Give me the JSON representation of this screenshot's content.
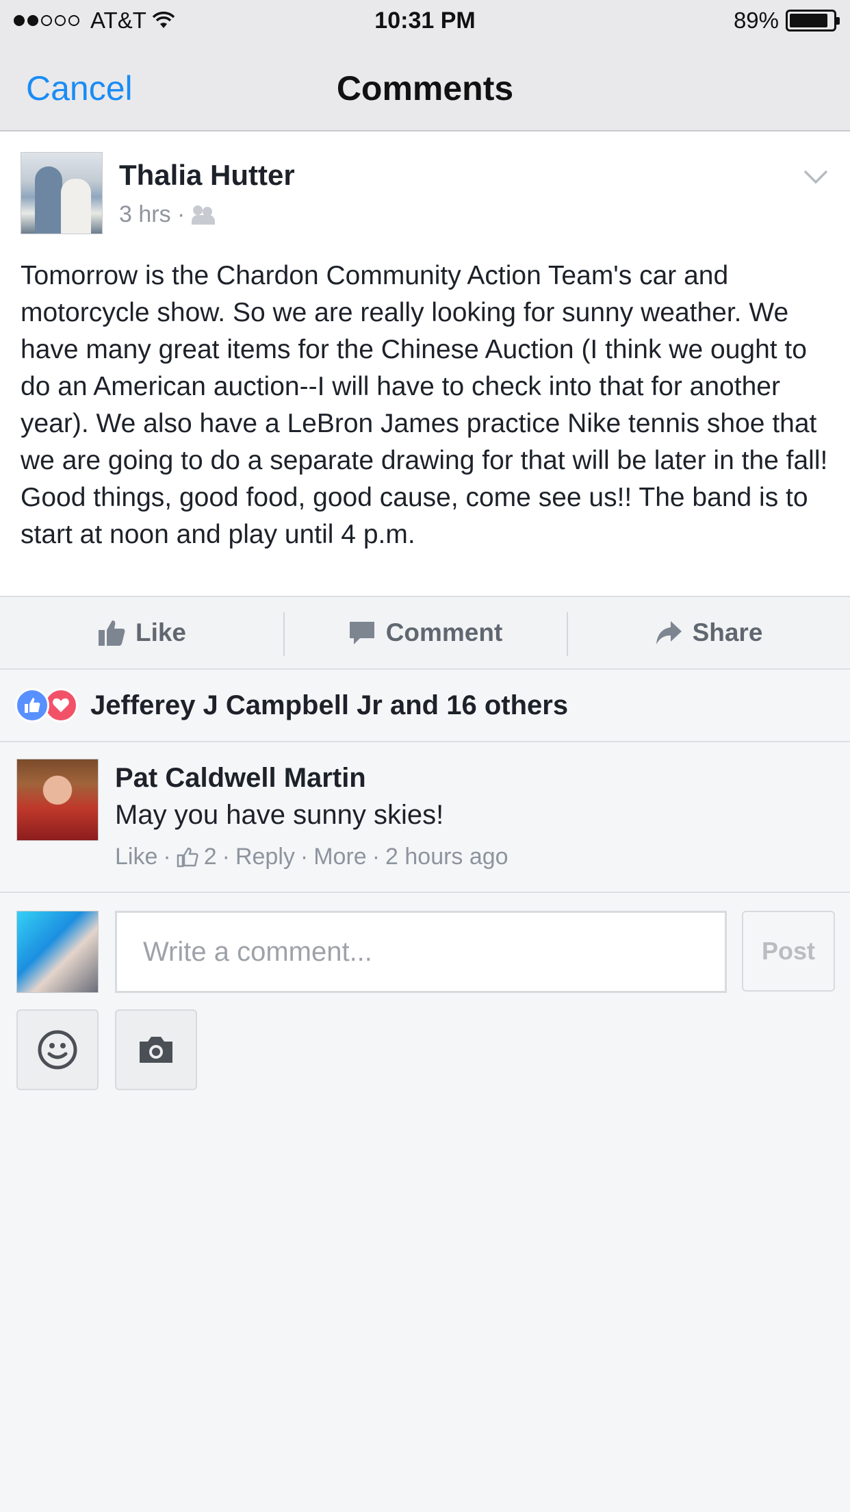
{
  "status_bar": {
    "carrier": "AT&T",
    "time": "10:31 PM",
    "battery": "89%",
    "battery_level": 0.89
  },
  "nav": {
    "cancel_label": "Cancel",
    "title": "Comments"
  },
  "post": {
    "author": "Thalia Hutter",
    "time": "3 hrs ·",
    "audience_icon": "friends-icon",
    "text": "Tomorrow is the Chardon Community Action Team's car and motorcycle show. So we are really looking for sunny weather. We have many great items for the Chinese Auction (I think we ought to do an American auction--I will have to check into that for another year). We also have a LeBron James practice Nike tennis shoe that we are going to do a separate drawing for that will be later in the fall! Good things, good food, good cause, come see us!! The band is to start at noon and play until 4 p.m."
  },
  "actions": {
    "like": "Like",
    "comment": "Comment",
    "share": "Share"
  },
  "reactions": {
    "text": "Jefferey J Campbell Jr and 16 others",
    "like_color": "#5890ff",
    "love_color": "#f25268"
  },
  "comment": {
    "author": "Pat Caldwell Martin",
    "text": "May you have sunny skies!",
    "like": "Like",
    "sep": "·",
    "like_count": "2",
    "reply": "Reply",
    "more": "More",
    "time": "2 hours ago"
  },
  "composer": {
    "placeholder": "Write a comment...",
    "post_label": "Post"
  },
  "colors": {
    "link_blue": "#1a8cf5",
    "meta_gray": "#90949c"
  }
}
